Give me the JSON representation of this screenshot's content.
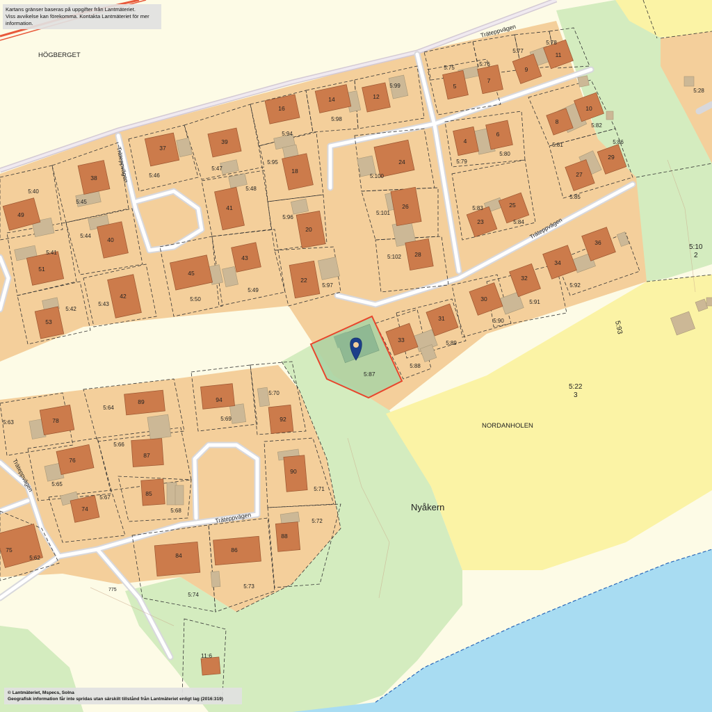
{
  "disclaimer": {
    "line1": "Kartans gränser baseras på uppgifter från Lantmäteriet.",
    "line2": "Viss avvikelse kan förekomma. Kontakta Lantmäteriet för mer information."
  },
  "copyright": {
    "line1": "© Lantmäteriet, Mspecs, Solna",
    "line2": "Geografisk information får inte spridas utan särskilt tillstånd från Lantmäteriet enligt lag (2016:319)"
  },
  "place_names": {
    "hogberget": "HÖGBERGET",
    "nordanholen": "NORDANHOLEN",
    "nyakern": "Nyåkern",
    "elevation": "775"
  },
  "street": "Träteppvägen",
  "selected_parcel": {
    "id": "5:87"
  },
  "large_parcels": {
    "p593": "5:93",
    "p522": "5:22",
    "p522_sub": "3",
    "p510": "5:10",
    "p510_sub": "2"
  },
  "house_numbers": [
    "37",
    "39",
    "16",
    "14",
    "12",
    "38",
    "49",
    "41",
    "18",
    "24",
    "26",
    "20",
    "28",
    "22",
    "45",
    "43",
    "40",
    "51",
    "42",
    "53",
    "5",
    "7",
    "9",
    "11",
    "4",
    "6",
    "8",
    "10",
    "27",
    "29",
    "25",
    "23",
    "34",
    "36",
    "32",
    "30",
    "31",
    "33",
    "78",
    "89",
    "94",
    "92",
    "76",
    "87",
    "90",
    "85",
    "74",
    "88",
    "84",
    "86",
    "75",
    "11:6"
  ],
  "parcel_ids": [
    "5:99",
    "5:98",
    "5:94",
    "5:47",
    "5:46",
    "5:40",
    "5:45",
    "5:95",
    "5:48",
    "5:100",
    "5:75",
    "5:76",
    "5:77",
    "5:78",
    "5:79",
    "5:80",
    "5:81",
    "5:82",
    "5:86",
    "5:83",
    "5:84",
    "5:85",
    "5:101",
    "5:102",
    "5:96",
    "5:97",
    "5:41",
    "5:44",
    "5:42",
    "5:43",
    "5:50",
    "5:49",
    "5:92",
    "5:91",
    "5:90",
    "5:89",
    "5:88",
    "5:63",
    "5:64",
    "5:69",
    "5:70",
    "5:66",
    "5:65",
    "5:67",
    "5:68",
    "5:71",
    "5:72",
    "5:62",
    "5:74",
    "5:73",
    "5:28"
  ],
  "colors": {
    "residential": "#f4cf9b",
    "park": "#d4ecbf",
    "open_field": "#fbf3a5",
    "unbuilt": "#fdfbe6",
    "water": "#a8dcf2",
    "road": "#d8d8dc",
    "house": "#cc7b4b",
    "outbuilding": "#ccb896",
    "selected_outline": "#e8452c",
    "selected_fill": "#a9d3a4",
    "pin": "#1c3f8a",
    "railway": "#e8593b"
  }
}
